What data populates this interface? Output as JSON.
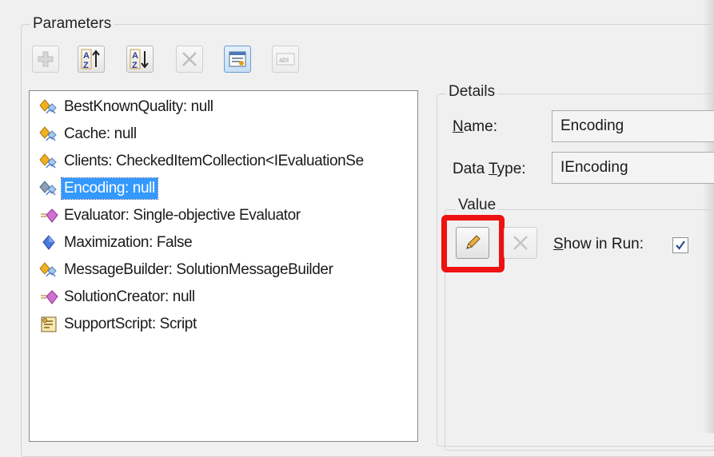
{
  "parameters": {
    "group_title": "Parameters",
    "toolbar": [
      {
        "name": "add-button",
        "icon": "plus-icon",
        "enabled": false
      },
      {
        "name": "sort-ascending-button",
        "icon": "sort-az-ascending-icon",
        "enabled": true
      },
      {
        "name": "sort-descending-button",
        "icon": "sort-az-descending-icon",
        "enabled": true
      },
      {
        "name": "remove-button",
        "icon": "x-icon",
        "enabled": false
      },
      {
        "name": "properties-button",
        "icon": "properties-icon",
        "enabled": true,
        "toggled": true
      },
      {
        "name": "rename-button",
        "icon": "text-field-icon",
        "enabled": false,
        "icon_text": "abl"
      }
    ],
    "items": [
      {
        "label": "BestKnownQuality: null",
        "icon": "value-parameter-icon",
        "selected": false
      },
      {
        "label": "Cache: null",
        "icon": "value-parameter-icon",
        "selected": false
      },
      {
        "label": "Clients: CheckedItemCollection<IEvaluationSe",
        "icon": "value-parameter-icon",
        "selected": false
      },
      {
        "label": "Encoding: null",
        "icon": "value-parameter-icon",
        "selected": true
      },
      {
        "label": "Evaluator: Single-objective Evaluator",
        "icon": "operator-parameter-icon",
        "selected": false
      },
      {
        "label": "Maximization: False",
        "icon": "fixed-value-icon",
        "selected": false
      },
      {
        "label": "MessageBuilder: SolutionMessageBuilder",
        "icon": "value-parameter-icon",
        "selected": false
      },
      {
        "label": "SolutionCreator: null",
        "icon": "operator-parameter-icon",
        "selected": false
      },
      {
        "label": "SupportScript: Script",
        "icon": "script-icon",
        "selected": false
      }
    ]
  },
  "details": {
    "group_title": "Details",
    "name_label_u": "N",
    "name_label_rest": "ame:",
    "name_value": "Encoding",
    "type_label_pre": "Data ",
    "type_label_u": "T",
    "type_label_rest": "ype:",
    "type_value": "IEncoding",
    "value_group_title": "Value",
    "show_in_run_u": "S",
    "show_in_run_rest": "how in Run:",
    "show_in_run_checked": true
  },
  "colors": {
    "selection": "#3399ff",
    "highlight": "#ee1111"
  }
}
